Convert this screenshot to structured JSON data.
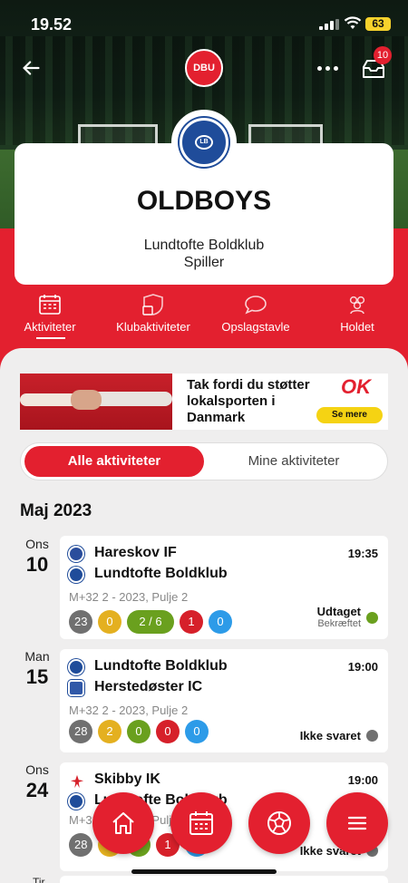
{
  "status_bar": {
    "time": "19.52",
    "battery": "63"
  },
  "header": {
    "logo_text": "DBU",
    "inbox_badge": "10"
  },
  "team": {
    "name": "OLDBOYS",
    "club": "Lundtofte Boldklub",
    "role": "Spiller"
  },
  "tabs": [
    {
      "label": "Aktiviteter",
      "icon": "calendar-icon",
      "active": true
    },
    {
      "label": "Klubaktiviteter",
      "icon": "shield-calendar-icon",
      "active": false
    },
    {
      "label": "Opslagstavle",
      "icon": "speech-bubble-icon",
      "active": false
    },
    {
      "label": "Holdet",
      "icon": "group-icon",
      "active": false
    }
  ],
  "banner": {
    "text": "Tak fordi du støtter lokalsporten i Danmark",
    "brand": "OK",
    "cta": "Se mere"
  },
  "segment": {
    "all": "Alle aktiviteter",
    "mine": "Mine aktiviteter",
    "selected": "all"
  },
  "month": "Maj 2023",
  "colors": {
    "brand_red": "#e3202f",
    "grey": "#707070",
    "yellow": "#e4b020",
    "green": "#6aa01e",
    "red": "#d6202a",
    "blue": "#2d9be8"
  },
  "activities": [
    {
      "weekday": "Ons",
      "day": "10",
      "home": "Hareskov IF",
      "away": "Lundtofte Boldklub",
      "time": "19:35",
      "league": "M+32 2 - 2023, Pulje 2",
      "counts": [
        "23",
        "0",
        "2 / 6",
        "1",
        "0"
      ],
      "status": "Udtaget",
      "substatus": "Bekræftet",
      "status_color": "#6aa01e"
    },
    {
      "weekday": "Man",
      "day": "15",
      "home": "Lundtofte Boldklub",
      "away": "Herstedøster IC",
      "time": "19:00",
      "league": "M+32 2 - 2023, Pulje 2",
      "counts": [
        "28",
        "2",
        "0",
        "0",
        "0"
      ],
      "status": "Ikke svaret",
      "substatus": "",
      "status_color": "#707070"
    },
    {
      "weekday": "Ons",
      "day": "24",
      "home": "Skibby IK",
      "away": "Lundtofte Boldklub",
      "time": "19:00",
      "league": "M+32 2 - 2023, Pulje 2",
      "counts": [
        "28",
        "",
        "",
        "1",
        ""
      ],
      "status": "Ikke svaret",
      "substatus": "",
      "status_color": "#707070"
    }
  ],
  "next_weekday": "Tir",
  "fabs": [
    {
      "icon": "home-icon"
    },
    {
      "icon": "calendar-icon"
    },
    {
      "icon": "football-icon"
    },
    {
      "icon": "menu-icon"
    }
  ]
}
